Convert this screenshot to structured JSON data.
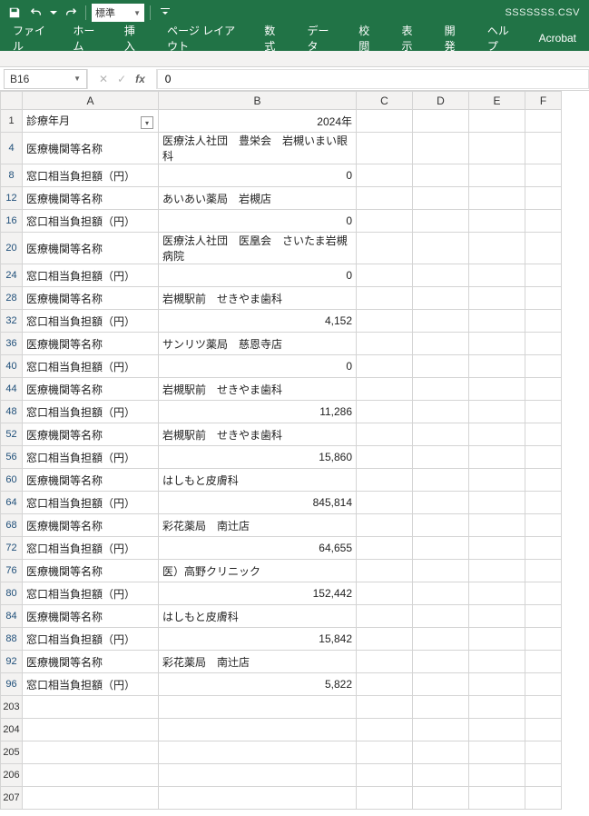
{
  "filename": "SSSSSSS.CSV",
  "quick_access": {
    "style_name": "標準"
  },
  "ribbon": {
    "tabs": [
      "ファイル",
      "ホーム",
      "挿入",
      "ページ レイアウト",
      "数式",
      "データ",
      "校閲",
      "表示",
      "開発",
      "ヘルプ",
      "Acrobat"
    ]
  },
  "formula_bar": {
    "name_box": "B16",
    "value": "0"
  },
  "columns": [
    "A",
    "B",
    "C",
    "D",
    "E",
    "F"
  ],
  "rows": [
    {
      "n": "1",
      "blk": true,
      "a": "診療年月",
      "a_filter": true,
      "b": "2024年",
      "b_align": "r"
    },
    {
      "n": "4",
      "a": "医療機関等名称",
      "b": "医療法人社団　豊栄会　岩槻いまい眼科",
      "b_align": "l"
    },
    {
      "n": "8",
      "a": "窓口相当負担額（円）",
      "b": "0",
      "b_align": "r"
    },
    {
      "n": "12",
      "a": "医療機関等名称",
      "b": "あいあい薬局　岩槻店",
      "b_align": "l"
    },
    {
      "n": "16",
      "a": "窓口相当負担額（円）",
      "b": "0",
      "b_align": "r"
    },
    {
      "n": "20",
      "a": "医療機関等名称",
      "b": "医療法人社団　医凰会　さいたま岩槻病院",
      "b_align": "l"
    },
    {
      "n": "24",
      "a": "窓口相当負担額（円）",
      "b": "0",
      "b_align": "r"
    },
    {
      "n": "28",
      "a": "医療機関等名称",
      "b": "岩槻駅前　せきやま歯科",
      "b_align": "l"
    },
    {
      "n": "32",
      "a": "窓口相当負担額（円）",
      "b": "4,152",
      "b_align": "r"
    },
    {
      "n": "36",
      "a": "医療機関等名称",
      "b": "サンリツ薬局　慈恩寺店",
      "b_align": "l"
    },
    {
      "n": "40",
      "a": "窓口相当負担額（円）",
      "b": "0",
      "b_align": "r"
    },
    {
      "n": "44",
      "a": "医療機関等名称",
      "b": "岩槻駅前　せきやま歯科",
      "b_align": "l"
    },
    {
      "n": "48",
      "a": "窓口相当負担額（円）",
      "b": "11,286",
      "b_align": "r"
    },
    {
      "n": "52",
      "a": "医療機関等名称",
      "b": "岩槻駅前　せきやま歯科",
      "b_align": "l"
    },
    {
      "n": "56",
      "a": "窓口相当負担額（円）",
      "b": "15,860",
      "b_align": "r"
    },
    {
      "n": "60",
      "a": "医療機関等名称",
      "b": "はしもと皮膚科",
      "b_align": "l"
    },
    {
      "n": "64",
      "a": "窓口相当負担額（円）",
      "b": "845,814",
      "b_align": "r"
    },
    {
      "n": "68",
      "a": "医療機関等名称",
      "b": "彩花薬局　南辻店",
      "b_align": "l"
    },
    {
      "n": "72",
      "a": "窓口相当負担額（円）",
      "b": "64,655",
      "b_align": "r"
    },
    {
      "n": "76",
      "a": "医療機関等名称",
      "b": "医）高野クリニック",
      "b_align": "l"
    },
    {
      "n": "80",
      "a": "窓口相当負担額（円）",
      "b": "152,442",
      "b_align": "r"
    },
    {
      "n": "84",
      "a": "医療機関等名称",
      "b": "はしもと皮膚科",
      "b_align": "l"
    },
    {
      "n": "88",
      "a": "窓口相当負担額（円）",
      "b": "15,842",
      "b_align": "r"
    },
    {
      "n": "92",
      "a": "医療機関等名称",
      "b": "彩花薬局　南辻店",
      "b_align": "l"
    },
    {
      "n": "96",
      "a": "窓口相当負担額（円）",
      "b": "5,822",
      "b_align": "r"
    },
    {
      "n": "203",
      "blk": true,
      "a": "",
      "b": ""
    },
    {
      "n": "204",
      "blk": true,
      "a": "",
      "b": ""
    },
    {
      "n": "205",
      "blk": true,
      "a": "",
      "b": ""
    },
    {
      "n": "206",
      "blk": true,
      "a": "",
      "b": ""
    },
    {
      "n": "207",
      "blk": true,
      "a": "",
      "b": ""
    }
  ]
}
